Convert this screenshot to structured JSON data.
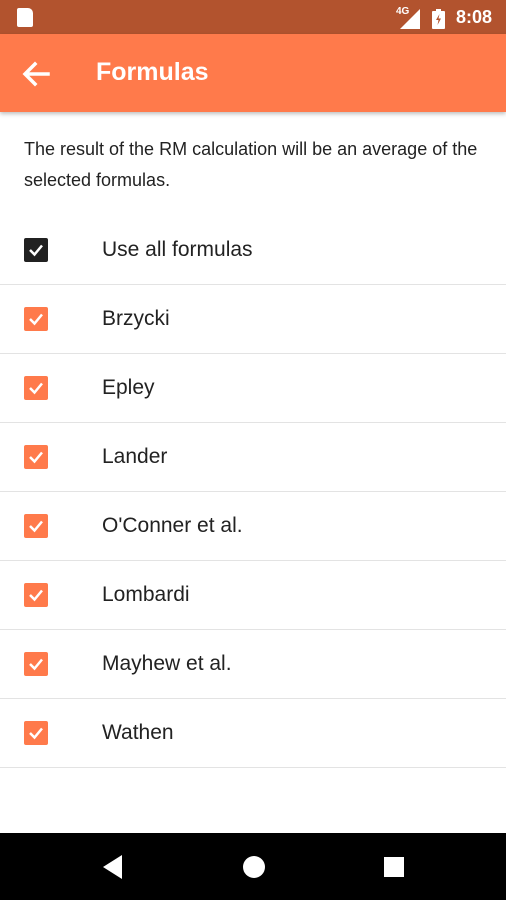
{
  "status_bar": {
    "network": "4G",
    "time": "8:08"
  },
  "app_bar": {
    "title": "Formulas",
    "back_icon": "arrow-left-icon"
  },
  "description": "The result of the RM calculation will be an average of the selected formulas.",
  "master_option": {
    "label": "Use all formulas",
    "checked": true,
    "color": "#212121"
  },
  "formulas": [
    {
      "label": "Brzycki",
      "checked": true
    },
    {
      "label": "Epley",
      "checked": true
    },
    {
      "label": "Lander",
      "checked": true
    },
    {
      "label": "O'Conner et al.",
      "checked": true
    },
    {
      "label": "Lombardi",
      "checked": true
    },
    {
      "label": "Mayhew et al.",
      "checked": true
    },
    {
      "label": "Wathen",
      "checked": true
    }
  ],
  "colors": {
    "accent": "#ff7a4b",
    "status_bar": "#b2532e",
    "checkbox_checked": "#ff7a4b",
    "master_checkbox": "#212121"
  },
  "nav_bar": {
    "back_icon": "triangle-back-icon",
    "home_icon": "circle-home-icon",
    "recents_icon": "square-recents-icon"
  }
}
